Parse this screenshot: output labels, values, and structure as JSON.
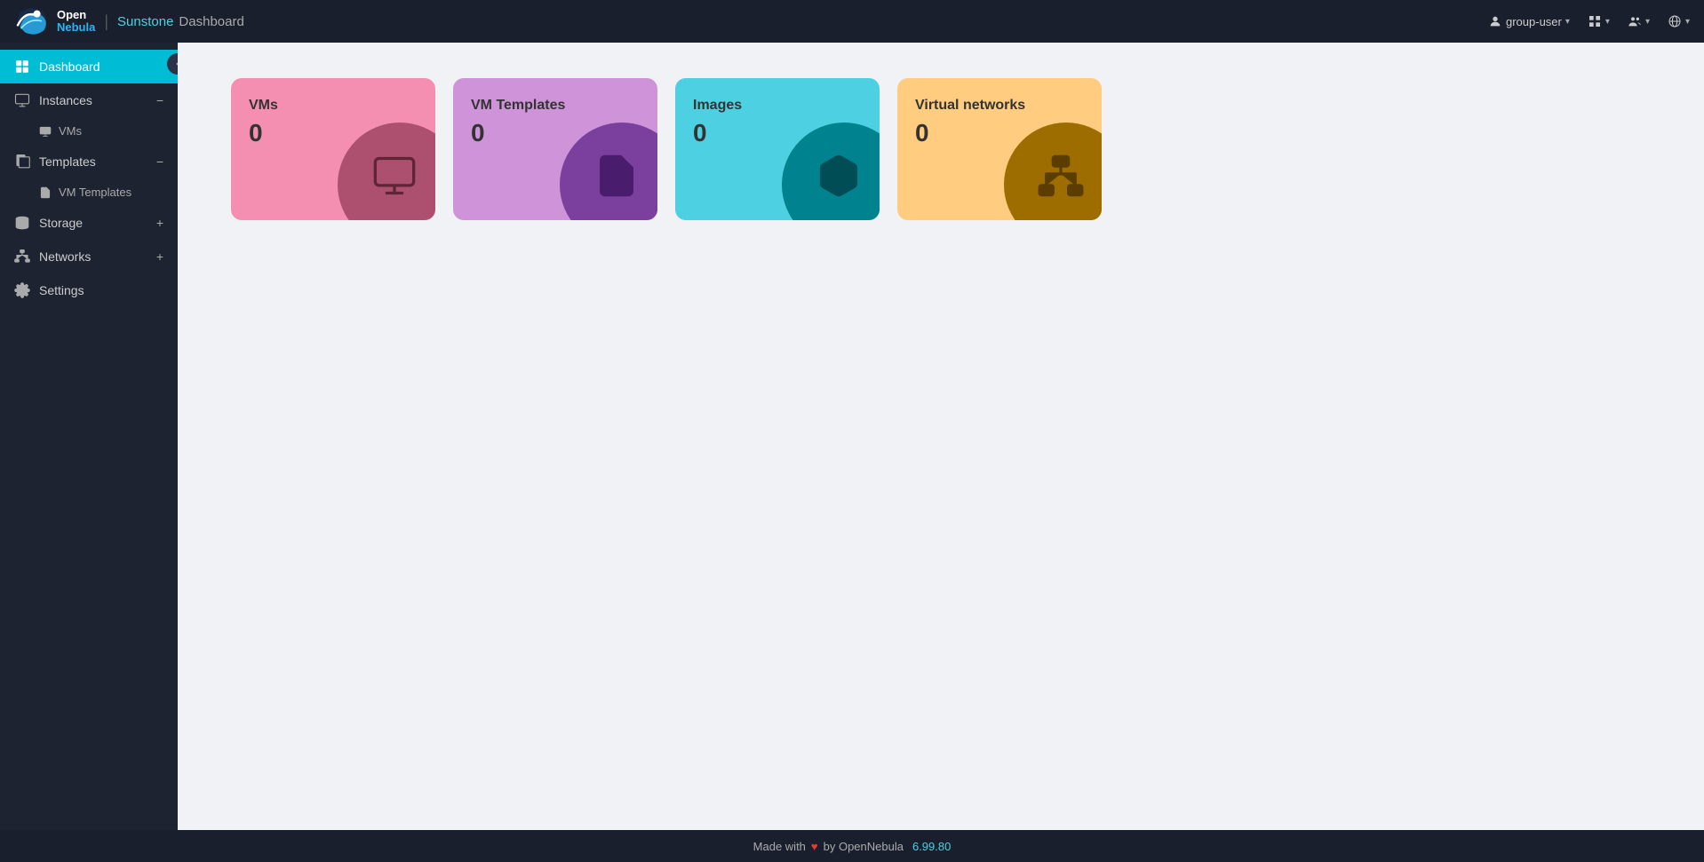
{
  "topbar": {
    "app_name": "Sunstone",
    "separator": "|",
    "page_title": "Dashboard",
    "user_label": "group-user",
    "chevron": "▾",
    "icons": {
      "user": "user-icon",
      "grid": "grid-icon",
      "people": "people-icon",
      "globe": "globe-icon"
    }
  },
  "sidebar": {
    "items": [
      {
        "id": "dashboard",
        "label": "Dashboard",
        "icon": "dashboard-icon",
        "active": true,
        "expandable": false
      },
      {
        "id": "instances",
        "label": "Instances",
        "icon": "instances-icon",
        "active": false,
        "expandable": true,
        "expanded": true
      },
      {
        "id": "templates",
        "label": "Templates",
        "icon": "templates-icon",
        "active": false,
        "expandable": true,
        "expanded": true
      },
      {
        "id": "storage",
        "label": "Storage",
        "icon": "storage-icon",
        "active": false,
        "expandable": true,
        "expanded": false
      },
      {
        "id": "networks",
        "label": "Networks",
        "icon": "networks-icon",
        "active": false,
        "expandable": true,
        "expanded": false
      },
      {
        "id": "settings",
        "label": "Settings",
        "icon": "settings-icon",
        "active": false,
        "expandable": false
      }
    ],
    "subitems": {
      "instances": [
        {
          "label": "VMs",
          "icon": "vm-icon"
        }
      ],
      "templates": [
        {
          "label": "VM Templates",
          "icon": "vmtemplate-icon"
        }
      ]
    }
  },
  "dashboard": {
    "cards": [
      {
        "id": "vms",
        "title": "VMs",
        "count": "0",
        "color_class": "card-vms"
      },
      {
        "id": "vmtemplates",
        "title": "VM Templates",
        "count": "0",
        "color_class": "card-vmtemplates"
      },
      {
        "id": "images",
        "title": "Images",
        "count": "0",
        "color_class": "card-images"
      },
      {
        "id": "vnets",
        "title": "Virtual networks",
        "count": "0",
        "color_class": "card-vnets"
      }
    ]
  },
  "footer": {
    "made_with": "Made with",
    "heart": "♥",
    "by": "by OpenNebula",
    "version": "6.99.80"
  }
}
